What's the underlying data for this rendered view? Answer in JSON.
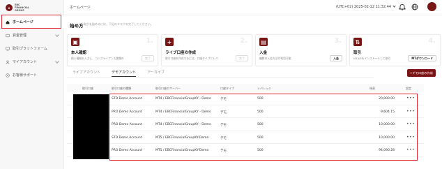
{
  "brand": {
    "logo_text": "EBC FINANCIAL GROUP",
    "accent": "#7a1515",
    "highlight": "#e0232e"
  },
  "sidebar": {
    "items": [
      {
        "label": "ホームページ",
        "icon": "home-icon",
        "active": true,
        "expandable": false
      },
      {
        "label": "資金管理",
        "icon": "wallet-icon",
        "active": false,
        "expandable": true
      },
      {
        "label": "取引プラットフォーム",
        "icon": "platform-icon",
        "active": false,
        "expandable": false
      },
      {
        "label": "マイアカウント",
        "icon": "user-icon",
        "active": false,
        "expandable": true
      },
      {
        "label": "お客様サポート",
        "icon": "support-icon",
        "active": false,
        "expandable": false
      }
    ]
  },
  "header": {
    "breadcrumb": "ホームページ",
    "datetime": "(UTC+02) 2025-02-12 11:32:44",
    "icons": [
      "bell-icon",
      "globe-icon",
      "avatar"
    ]
  },
  "getting_started": {
    "title": "始め方",
    "subtitle": "取引を始めるには、下記のタスクを完了してください。",
    "cards": [
      {
        "num": "1.",
        "icon": "id-icon",
        "title": "本人確認",
        "desc": "個人情報を入力し、コンプライアンス書類の",
        "button": "完了",
        "button_active": false
      },
      {
        "num": "2.",
        "icon": "plus-icon",
        "title": "ライブ口座の作成",
        "desc": "取引口座を作成するには、口座タイプとレバ",
        "button": "完了",
        "button_active": false
      },
      {
        "num": "3.",
        "icon": "deposit-icon",
        "title": "入金",
        "desc": "複数の入金方法が利用可能",
        "button": "入金",
        "button_active": true
      },
      {
        "num": "4.",
        "icon": "trade-icon",
        "title": "取引",
        "desc": "MT4/5をインストールして取引",
        "button": "MTダウンロード",
        "button_active": true
      }
    ]
  },
  "tabs": [
    {
      "label": "ライブアカウント",
      "active": false
    },
    {
      "label": "デモアカウント",
      "active": true
    },
    {
      "label": "アーカイブ",
      "active": false
    }
  ],
  "create_demo_button": "+デモ口座の作成",
  "table": {
    "headers": [
      "取引口座",
      "取引口座の種類",
      "取引口座のサーバー",
      "口座タイプ",
      "レバレッジ",
      "残高",
      "設定"
    ],
    "rows": [
      {
        "type": "STD Demo Account",
        "server": "MT4 / EBCFinancialGroupKY - Demo",
        "kind": "デモ",
        "leverage": "500",
        "balance": "20,000.00",
        "menu": "•••"
      },
      {
        "type": "PRO Demo Account",
        "server": "MT4 / EBCFinancialGroupKY - Demo",
        "kind": "デモ",
        "leverage": "500",
        "balance": "9,604.15",
        "menu": "•••"
      },
      {
        "type": "PRO Demo Account",
        "server": "MT4 / EBCFinancialGroupKY - Demo",
        "kind": "デモ",
        "leverage": "500",
        "balance": "10,000.00",
        "menu": "•••"
      },
      {
        "type": "STD Demo Account",
        "server": "MT5 / EBCFinancialGroupKY-Demo",
        "kind": "デモ",
        "leverage": "500",
        "balance": "10,000.00",
        "menu": "•••"
      },
      {
        "type": "PRO Demo Account",
        "server": "MT5 / EBCFinancialGroupKY-Demo",
        "kind": "デモ",
        "leverage": "500",
        "balance": "94,090.28",
        "menu": "•••"
      }
    ]
  }
}
